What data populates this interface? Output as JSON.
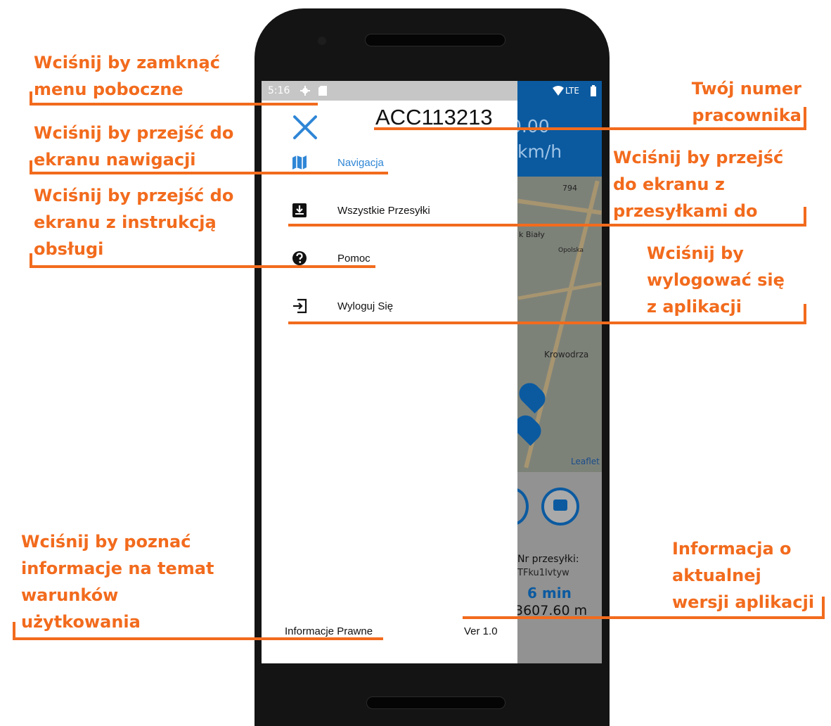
{
  "annotations": {
    "close_menu": "Wciśnij by zamknąć menu poboczne",
    "nav_screen": "Wciśnij by przejść do ekranu nawigacji",
    "help_screen": "Wciśnij by przejść do ekranu z instrukcją obsługi",
    "legal_info": "Wciśnij by poznać informacje na temat warunków użytkowania",
    "employee_number": "Twój numer pracownika",
    "shipments_screen": "Wciśnij by przejść do ekranu z przesyłkami do",
    "logout": "Wciśnij by wylogować się z aplikacji",
    "version_info": "Informacja o aktualnej wersji aplikacji"
  },
  "annotation_lines": {
    "close_menu": [
      "Wciśnij by zamknąć",
      "menu poboczne"
    ],
    "nav_screen": [
      "Wciśnij by przejść do",
      "ekranu nawigacji"
    ],
    "help_screen": [
      "Wciśnij by przejść do",
      "ekranu z instrukcją",
      "obsługi"
    ],
    "legal_info": [
      "Wciśnij by poznać",
      "informacje na temat",
      "warunków",
      "użytkowania"
    ],
    "employee_number": [
      "Twój numer",
      "pracownika"
    ],
    "shipments_screen": [
      "Wciśnij by przejść",
      "do ekranu z",
      "przesyłkami do"
    ],
    "logout": [
      "Wciśnij by",
      "wylogować się",
      "z aplikacji"
    ],
    "version_info": [
      "Informacja o",
      "aktualnej",
      "wersji aplikacji"
    ]
  },
  "status_bar": {
    "time": "5:16",
    "network": "LTE"
  },
  "drawer": {
    "employee_id": "ACC113213",
    "menu": [
      {
        "label": "Navigacja",
        "icon": "map-icon",
        "active": true
      },
      {
        "label": "Wszystkie Przesyłki",
        "icon": "inbox-download-icon",
        "active": false
      },
      {
        "label": "Pomoc",
        "icon": "help-circle-icon",
        "active": false
      },
      {
        "label": "Wyloguj Się",
        "icon": "logout-icon",
        "active": false
      }
    ],
    "legal_link": "Informacje Prawne",
    "version": "Ver 1.0"
  },
  "background_app": {
    "speed_value": "0.00",
    "speed_unit": "km/h",
    "map_labels": [
      "794",
      "k Biały",
      "Opolska",
      "Krowodrza"
    ],
    "map_attribution": "Leaflet",
    "shipment_label": "Nr przesyłki:",
    "shipment_id": "TFku1lvtyw",
    "eta": "6 min",
    "distance": "3607.60 m"
  },
  "colors": {
    "annotation": "#f26b1d",
    "accent_blue": "#0b5aa0",
    "active_menu": "#2f86d6",
    "phone_body": "#141414"
  }
}
